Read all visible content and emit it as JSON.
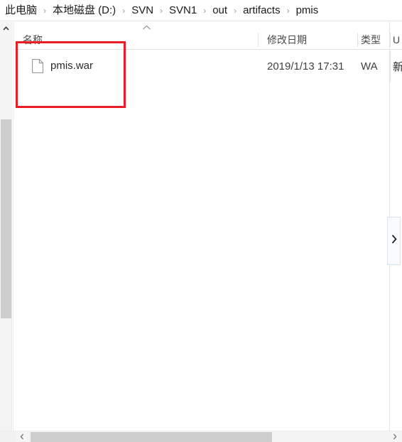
{
  "window": {
    "title": "pmis"
  },
  "breadcrumb": {
    "separator": "›",
    "items": [
      {
        "label": "此电脑"
      },
      {
        "label": "本地磁盘 (D:)"
      },
      {
        "label": "SVN"
      },
      {
        "label": "SVN1"
      },
      {
        "label": "out"
      },
      {
        "label": "artifacts"
      },
      {
        "label": "pmis"
      }
    ]
  },
  "file_list": {
    "columns": [
      {
        "key": "name",
        "label": "名称"
      },
      {
        "key": "date",
        "label": "修改日期"
      },
      {
        "key": "type",
        "label": "类型"
      },
      {
        "key": "extra",
        "label": "U"
      }
    ],
    "sort": {
      "column": "name",
      "direction": "ascending",
      "indicator_icon": "chevron-up-icon"
    },
    "rows": [
      {
        "icon": "file-icon",
        "name": "pmis.war",
        "date": "2019/1/13 17:31",
        "type": "WA",
        "extra": "新"
      }
    ]
  },
  "annotation": {
    "shape": "rectangle",
    "color": "#ed1c24",
    "target": "pmis.war"
  },
  "controls": {
    "scroll_up_icon": "chevron-up-icon",
    "expand_pane_icon": "chevron-right-icon",
    "hscroll_left_icon": "chevron-left-icon",
    "hscroll_right_icon": "chevron-right-icon"
  },
  "colors": {
    "annotation": "#ed1c24",
    "scroll_thumb": "#cdcdcd",
    "scroll_track": "#f4f4f4",
    "header_text": "#4a4a4a",
    "body_text": "#2b2b2b"
  }
}
